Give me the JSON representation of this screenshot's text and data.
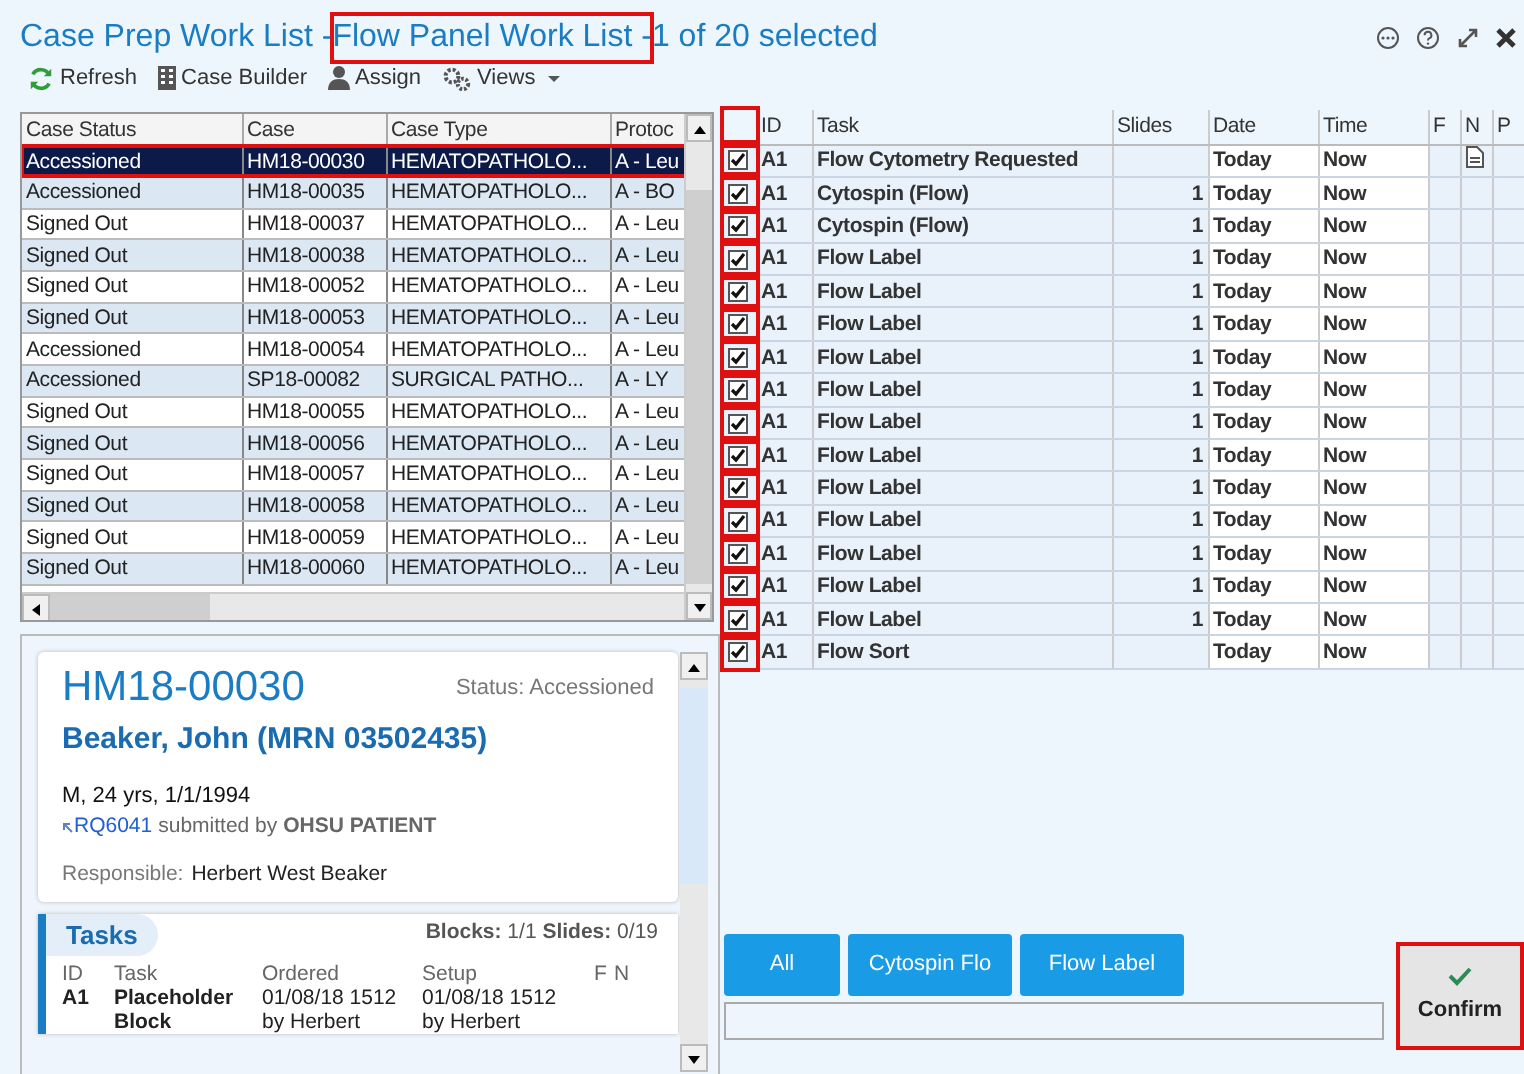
{
  "window": {
    "title": "Case Prep Work List - ",
    "subtitle": {
      "text": "Flow Panel Work List - ",
      "highlighted": true
    },
    "count": "1 of 20 selected"
  },
  "toolbar": [
    {
      "kind": "refresh",
      "label": "Refresh"
    },
    {
      "kind": "builder",
      "label": "Case Builder"
    },
    {
      "kind": "assign",
      "label": "Assign"
    },
    {
      "kind": "views",
      "label": "Views"
    }
  ],
  "case_table": {
    "columns": [
      "Case Status",
      "Case",
      "Case Type",
      "Protoc"
    ],
    "rows": [
      {
        "cells": [
          "Accessioned",
          "HM18-00030",
          "HEMATOPATHOLO...",
          "A - Leu"
        ],
        "selected": true,
        "highlighted": true
      },
      {
        "cells": [
          "Accessioned",
          "HM18-00035",
          "HEMATOPATHOLO...",
          "A - BO"
        ],
        "selected": false,
        "highlighted": false
      },
      {
        "cells": [
          "Signed Out",
          "HM18-00037",
          "HEMATOPATHOLO...",
          "A - Leu"
        ],
        "selected": false,
        "highlighted": false
      },
      {
        "cells": [
          "Signed Out",
          "HM18-00038",
          "HEMATOPATHOLO...",
          "A - Leu"
        ],
        "selected": false,
        "highlighted": false
      },
      {
        "cells": [
          "Signed Out",
          "HM18-00052",
          "HEMATOPATHOLO...",
          "A - Leu"
        ],
        "selected": false,
        "highlighted": false
      },
      {
        "cells": [
          "Signed Out",
          "HM18-00053",
          "HEMATOPATHOLO...",
          "A - Leu"
        ],
        "selected": false,
        "highlighted": false
      },
      {
        "cells": [
          "Accessioned",
          "HM18-00054",
          "HEMATOPATHOLO...",
          "A - Leu"
        ],
        "selected": false,
        "highlighted": false
      },
      {
        "cells": [
          "Accessioned",
          "SP18-00082",
          "SURGICAL PATHO...",
          "A - LY"
        ],
        "selected": false,
        "highlighted": false
      },
      {
        "cells": [
          "Signed Out",
          "HM18-00055",
          "HEMATOPATHOLO...",
          "A - Leu"
        ],
        "selected": false,
        "highlighted": false
      },
      {
        "cells": [
          "Signed Out",
          "HM18-00056",
          "HEMATOPATHOLO...",
          "A - Leu"
        ],
        "selected": false,
        "highlighted": false
      },
      {
        "cells": [
          "Signed Out",
          "HM18-00057",
          "HEMATOPATHOLO...",
          "A - Leu"
        ],
        "selected": false,
        "highlighted": false
      },
      {
        "cells": [
          "Signed Out",
          "HM18-00058",
          "HEMATOPATHOLO...",
          "A - Leu"
        ],
        "selected": false,
        "highlighted": false
      },
      {
        "cells": [
          "Signed Out",
          "HM18-00059",
          "HEMATOPATHOLO...",
          "A - Leu"
        ],
        "selected": false,
        "highlighted": false
      },
      {
        "cells": [
          "Signed Out",
          "HM18-00060",
          "HEMATOPATHOLO...",
          "A - Leu"
        ],
        "selected": false,
        "highlighted": false
      }
    ]
  },
  "case_card": {
    "case": "HM18-00030",
    "status": "Status: Accessioned",
    "patient": "Beaker, John (MRN 03502435)",
    "demographics": "M, 24 yrs, 1/1/1994",
    "requisition": "RQ6041",
    "submitted": "submitted by **OHSU PATIENT**",
    "responsible_label": "Responsible:",
    "responsible": "Herbert West Beaker",
    "tasks": {
      "title": "Tasks",
      "summary": "**Blocks:** 1/1 **Slides:** 0/19",
      "columns": [
        "ID",
        "Task",
        "Ordered",
        "Setup",
        "F",
        "N"
      ],
      "rows": [
        {
          "id": "A1",
          "task": [
            "Placeholder",
            "Block"
          ],
          "ordered": [
            "01/08/18 1512",
            "by Herbert"
          ],
          "setup": [
            "01/08/18 1512",
            "by Herbert"
          ]
        }
      ]
    }
  },
  "task_table": {
    "checkboxes_highlighted": true,
    "columns": [
      "ID",
      "Task",
      "Slides",
      "Date",
      "Time",
      "F",
      "N",
      "P"
    ],
    "rows": [
      {
        "checked": true,
        "id": "A1",
        "task": "Flow Cytometry Requested",
        "slides": "",
        "date": "Today",
        "time": "Now",
        "note": true
      },
      {
        "checked": true,
        "id": "A1",
        "task": "Cytospin (Flow)",
        "slides": "1",
        "date": "Today",
        "time": "Now",
        "note": false
      },
      {
        "checked": true,
        "id": "A1",
        "task": "Cytospin (Flow)",
        "slides": "1",
        "date": "Today",
        "time": "Now",
        "note": false
      },
      {
        "checked": true,
        "id": "A1",
        "task": "Flow Label",
        "slides": "1",
        "date": "Today",
        "time": "Now",
        "note": false
      },
      {
        "checked": true,
        "id": "A1",
        "task": "Flow Label",
        "slides": "1",
        "date": "Today",
        "time": "Now",
        "note": false
      },
      {
        "checked": true,
        "id": "A1",
        "task": "Flow Label",
        "slides": "1",
        "date": "Today",
        "time": "Now",
        "note": false
      },
      {
        "checked": true,
        "id": "A1",
        "task": "Flow Label",
        "slides": "1",
        "date": "Today",
        "time": "Now",
        "note": false
      },
      {
        "checked": true,
        "id": "A1",
        "task": "Flow Label",
        "slides": "1",
        "date": "Today",
        "time": "Now",
        "note": false
      },
      {
        "checked": true,
        "id": "A1",
        "task": "Flow Label",
        "slides": "1",
        "date": "Today",
        "time": "Now",
        "note": false
      },
      {
        "checked": true,
        "id": "A1",
        "task": "Flow Label",
        "slides": "1",
        "date": "Today",
        "time": "Now",
        "note": false
      },
      {
        "checked": true,
        "id": "A1",
        "task": "Flow Label",
        "slides": "1",
        "date": "Today",
        "time": "Now",
        "note": false
      },
      {
        "checked": true,
        "id": "A1",
        "task": "Flow Label",
        "slides": "1",
        "date": "Today",
        "time": "Now",
        "note": false
      },
      {
        "checked": true,
        "id": "A1",
        "task": "Flow Label",
        "slides": "1",
        "date": "Today",
        "time": "Now",
        "note": false
      },
      {
        "checked": true,
        "id": "A1",
        "task": "Flow Label",
        "slides": "1",
        "date": "Today",
        "time": "Now",
        "note": false
      },
      {
        "checked": true,
        "id": "A1",
        "task": "Flow Label",
        "slides": "1",
        "date": "Today",
        "time": "Now",
        "note": false
      },
      {
        "checked": true,
        "id": "A1",
        "task": "Flow Sort",
        "slides": "",
        "date": "Today",
        "time": "Now",
        "note": false
      }
    ]
  },
  "filter_buttons": [
    "All",
    "Cytospin Flo",
    "Flow Label"
  ],
  "confirm": {
    "label": "Confirm",
    "highlighted": true
  }
}
